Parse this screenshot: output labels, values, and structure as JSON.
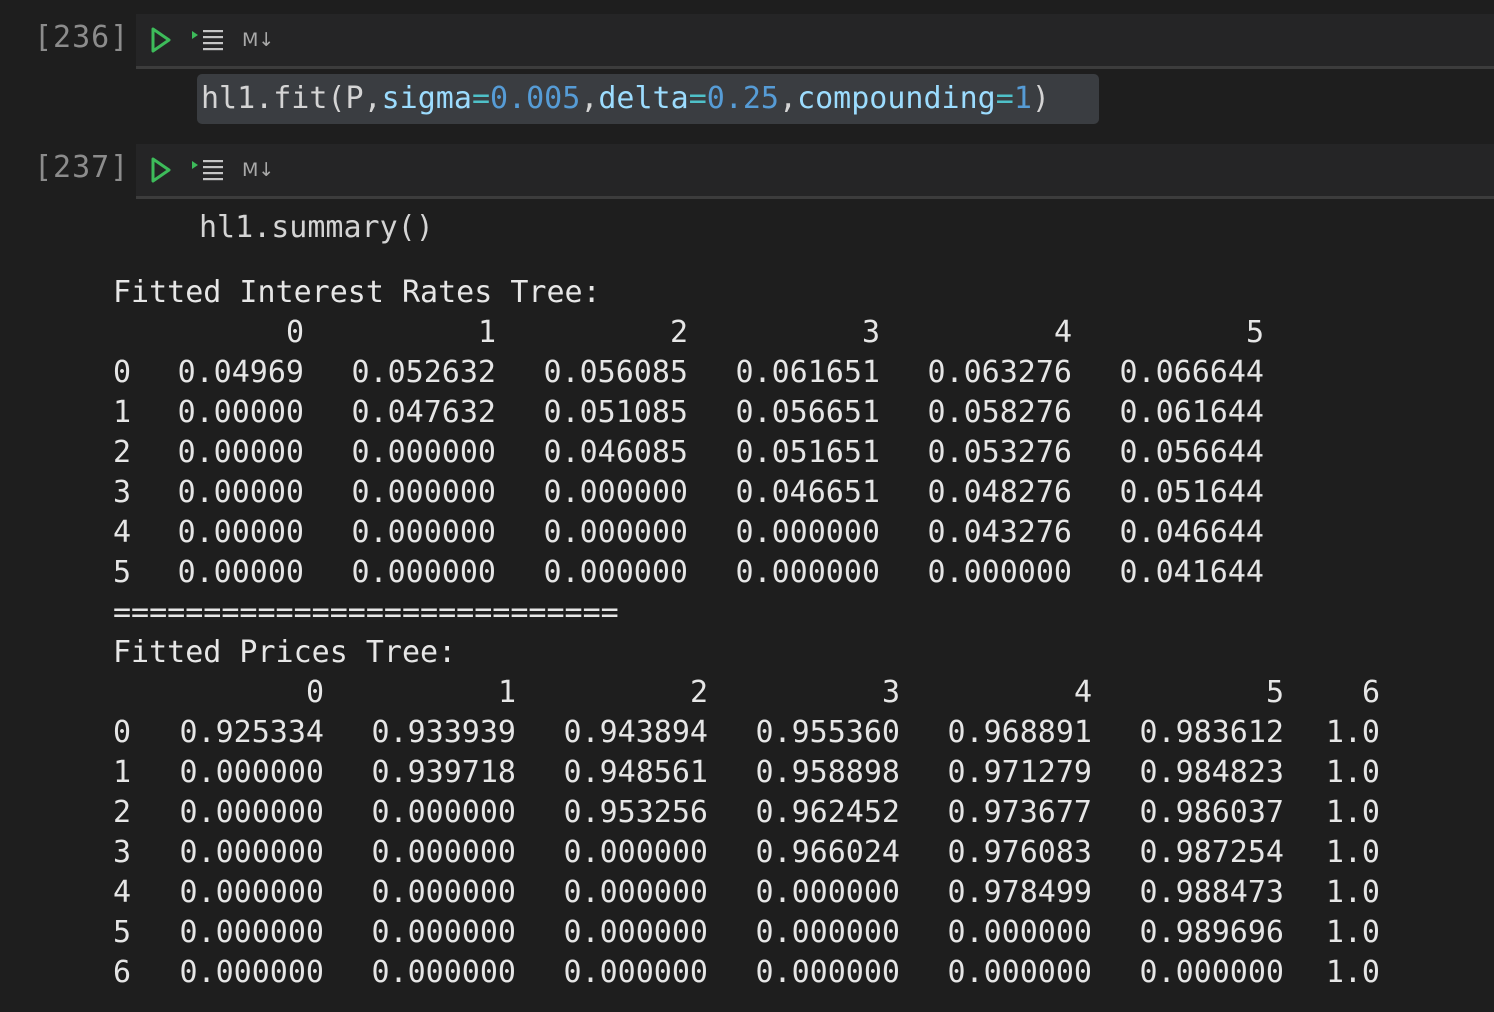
{
  "cells": [
    {
      "execution_count": "[236]",
      "markdown_toggle": "M↓",
      "code": {
        "func": "hl1.fit(",
        "arg0": "P",
        "comma1": ",",
        "p1": "sigma",
        "eq1": "=",
        "v1": "0.005",
        "comma2": ",",
        "p2": "delta",
        "eq2": "=",
        "v2": "0.25",
        "comma3": ",",
        "p3": "compounding",
        "eq3": "=",
        "v3": "1",
        "close": ")"
      }
    },
    {
      "execution_count": "[237]",
      "markdown_toggle": "M↓",
      "code_text": "hl1.summary()"
    }
  ],
  "output": {
    "rates_title": "Fitted Interest Rates Tree:",
    "rates_header": [
      "0",
      "1",
      "2",
      "3",
      "4",
      "5"
    ],
    "rates_rows": [
      [
        "0",
        "0.04969",
        "0.052632",
        "0.056085",
        "0.061651",
        "0.063276",
        "0.066644"
      ],
      [
        "1",
        "0.00000",
        "0.047632",
        "0.051085",
        "0.056651",
        "0.058276",
        "0.061644"
      ],
      [
        "2",
        "0.00000",
        "0.000000",
        "0.046085",
        "0.051651",
        "0.053276",
        "0.056644"
      ],
      [
        "3",
        "0.00000",
        "0.000000",
        "0.000000",
        "0.046651",
        "0.048276",
        "0.051644"
      ],
      [
        "4",
        "0.00000",
        "0.000000",
        "0.000000",
        "0.000000",
        "0.043276",
        "0.046644"
      ],
      [
        "5",
        "0.00000",
        "0.000000",
        "0.000000",
        "0.000000",
        "0.000000",
        "0.041644"
      ]
    ],
    "separator": "============================",
    "prices_title": "Fitted Prices Tree:",
    "prices_header": [
      "0",
      "1",
      "2",
      "3",
      "4",
      "5",
      "6"
    ],
    "prices_rows": [
      [
        "0",
        "0.925334",
        "0.933939",
        "0.943894",
        "0.955360",
        "0.968891",
        "0.983612",
        "1.0"
      ],
      [
        "1",
        "0.000000",
        "0.939718",
        "0.948561",
        "0.958898",
        "0.971279",
        "0.984823",
        "1.0"
      ],
      [
        "2",
        "0.000000",
        "0.000000",
        "0.953256",
        "0.962452",
        "0.973677",
        "0.986037",
        "1.0"
      ],
      [
        "3",
        "0.000000",
        "0.000000",
        "0.000000",
        "0.966024",
        "0.976083",
        "0.987254",
        "1.0"
      ],
      [
        "4",
        "0.000000",
        "0.000000",
        "0.000000",
        "0.000000",
        "0.978499",
        "0.988473",
        "1.0"
      ],
      [
        "5",
        "0.000000",
        "0.000000",
        "0.000000",
        "0.000000",
        "0.000000",
        "0.989696",
        "1.0"
      ],
      [
        "6",
        "0.000000",
        "0.000000",
        "0.000000",
        "0.000000",
        "0.000000",
        "0.000000",
        "1.0"
      ]
    ]
  }
}
